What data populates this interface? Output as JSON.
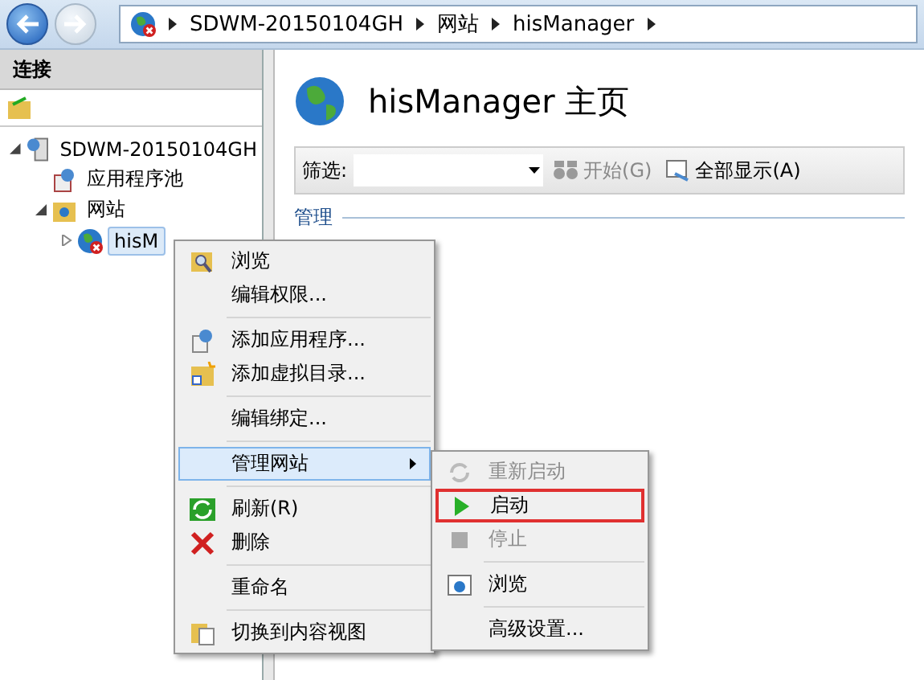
{
  "address_bar": {
    "segments": [
      "SDWM-20150104GH",
      "网站",
      "hisManager"
    ]
  },
  "connections": {
    "title": "连接",
    "tree": [
      {
        "label": "SDWM-20150104GH",
        "expanded": true,
        "selected": false,
        "children": [
          {
            "label": "应用程序池",
            "selected": false
          },
          {
            "label": "网站",
            "expanded": true,
            "selected": false,
            "children": [
              {
                "label": "hisM",
                "expanded": false,
                "selected": true
              }
            ]
          }
        ]
      }
    ]
  },
  "main": {
    "title": "hisManager 主页",
    "filter_label": "筛选:",
    "go_button": {
      "label": "开始(G)",
      "disabled": true
    },
    "show_all_button": "全部显示(A)",
    "group": "管理"
  },
  "context_menu": {
    "items": [
      {
        "kind": "item",
        "label": "浏览",
        "selected": false,
        "submenu": false
      },
      {
        "kind": "item",
        "label": "编辑权限...",
        "selected": false,
        "submenu": false
      },
      {
        "kind": "separator"
      },
      {
        "kind": "item",
        "label": "添加应用程序...",
        "selected": false,
        "submenu": false
      },
      {
        "kind": "item",
        "label": "添加虚拟目录...",
        "selected": false,
        "submenu": false
      },
      {
        "kind": "separator"
      },
      {
        "kind": "item",
        "label": "编辑绑定...",
        "selected": false,
        "submenu": false
      },
      {
        "kind": "separator"
      },
      {
        "kind": "item",
        "label": "管理网站",
        "selected": true,
        "submenu": true
      },
      {
        "kind": "separator"
      },
      {
        "kind": "item",
        "label": "刷新(R)",
        "selected": false,
        "submenu": false
      },
      {
        "kind": "item",
        "label": "删除",
        "selected": false,
        "submenu": false
      },
      {
        "kind": "separator"
      },
      {
        "kind": "item",
        "label": "重命名",
        "selected": false,
        "submenu": false
      },
      {
        "kind": "separator"
      },
      {
        "kind": "item",
        "label": "切换到内容视图",
        "selected": false,
        "submenu": false
      }
    ]
  },
  "submenu": {
    "items": [
      {
        "kind": "item",
        "label": "重新启动",
        "disabled": true,
        "highlighted": false
      },
      {
        "kind": "item",
        "label": "启动",
        "disabled": false,
        "highlighted": true
      },
      {
        "kind": "item",
        "label": "停止",
        "disabled": true,
        "highlighted": false
      },
      {
        "kind": "separator"
      },
      {
        "kind": "item",
        "label": "浏览",
        "disabled": false,
        "highlighted": false
      },
      {
        "kind": "separator"
      },
      {
        "kind": "item",
        "label": "高级设置...",
        "disabled": false,
        "highlighted": false
      }
    ]
  }
}
